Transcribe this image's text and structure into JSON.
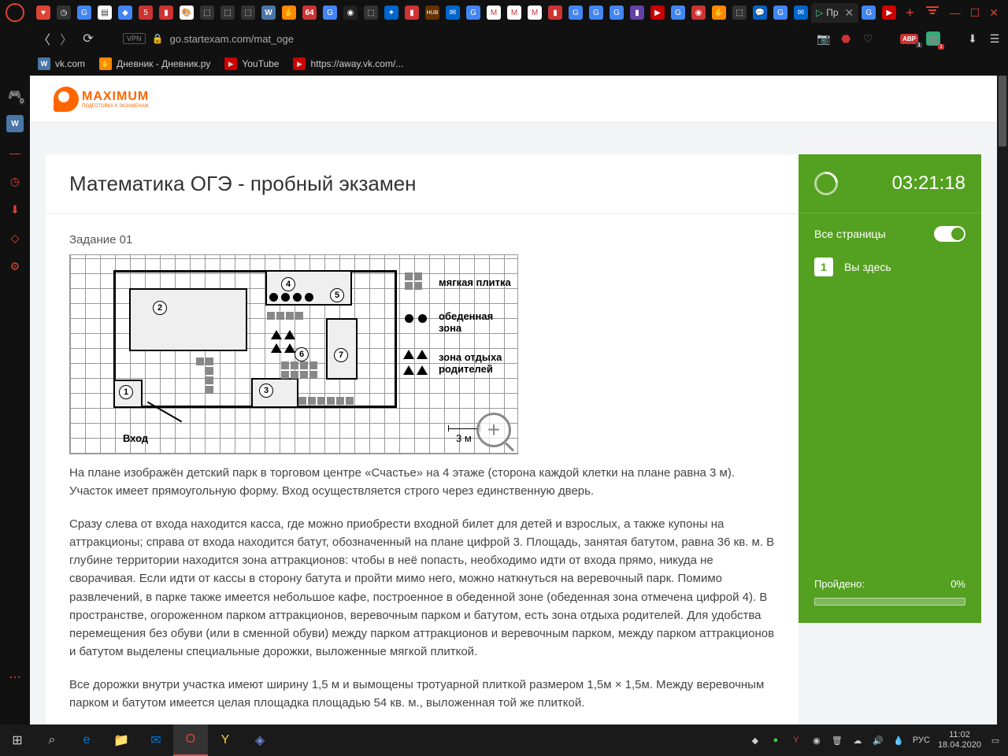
{
  "browser": {
    "url": "go.startexam.com/mat_oge",
    "vpn": "VPN",
    "active_tab_prefix": "▷",
    "active_tab_label": "Пр",
    "abp_label": "ABP",
    "abp_badge": "1",
    "ext_badge": "1"
  },
  "bookmarks": [
    {
      "label": "vk.com"
    },
    {
      "label": "Дневник - Дневник.ру"
    },
    {
      "label": "YouTube"
    },
    {
      "label": "https://away.vk.com/..."
    }
  ],
  "site": {
    "logo_text": "MAXIMUM",
    "logo_sub": "ПОДГОТОВКА К ЭКЗАМЕНАМ"
  },
  "exam": {
    "title": "Математика ОГЭ - пробный экзамен",
    "task_label": "Задание 01",
    "timer": "03:21:18",
    "pages_label": "Все страницы",
    "here_num": "1",
    "here_label": "Вы здесь",
    "progress_label": "Пройдено:",
    "progress_value": "0%"
  },
  "plan": {
    "entry": "Вход",
    "scale": "3 м",
    "legend1": "мягкая плитка",
    "legend2": "обеденная зона",
    "legend3": "зона отдыха родителей",
    "n1": "1",
    "n2": "2",
    "n3": "3",
    "n4": "4",
    "n5": "5",
    "n6": "6",
    "n7": "7"
  },
  "paragraphs": {
    "p1": "На плане изображён детский парк в торговом центре «Счастье» на 4 этаже (сторона каждой клетки на плане равна 3 м). Участок имеет прямоугольную форму. Вход осуществляется строго через единственную дверь.",
    "p2": "Сразу слева от входа находится касса, где можно приобрести входной билет для детей и взрослых, а также купоны на аттракционы; справа от входа находится батут, обозначенный на плане цифрой 3. Площадь, занятая батутом, равна 36 кв. м. В глубине территории находится зона аттракционов: чтобы в неё попасть, необходимо идти от входа прямо, никуда не сворачивая. Если идти от кассы в сторону батута и пройти мимо него, можно наткнуться на веревочный парк. Помимо развлечений, в парке также имеется небольшое кафе, построенное в обеденной зоне (обеденная зона отмечена цифрой 4). В пространстве, огороженном парком аттракционов, веревочным парком и батутом, есть зона отдыха родителей. Для удобства перемещения без обуви (или в сменной обуви) между парком аттракционов и веревочным парком, между парком аттракционов и батутом выделены специальные дорожки, выложенные мягкой плиткой.",
    "p3": "Все дорожки внутри участка имеют ширину 1,5 м и вымощены тротуарной плиткой размером 1,5м × 1,5м.  Между веревочным парком и батутом имеется целая площадка площадью 54 кв. м., выложенная той же плиткой."
  },
  "taskbar": {
    "lang": "РУС",
    "time": "11:02",
    "date": "18.04.2020"
  }
}
